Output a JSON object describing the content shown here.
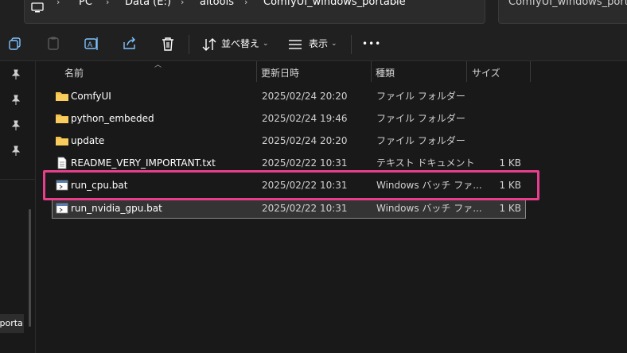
{
  "breadcrumb": {
    "items": [
      "PC",
      "Data (E:)",
      "aitools",
      "ComfyUI_windows_portable"
    ],
    "separator": "›"
  },
  "search": {
    "text": "ComfyUI_windows_porta"
  },
  "toolbar": {
    "sort_label": "並べ替え",
    "view_label": "表示",
    "more_label": "•••"
  },
  "columns": {
    "name": "名前",
    "date": "更新日時",
    "type": "種類",
    "size": "サイズ"
  },
  "files": [
    {
      "icon": "folder-icon",
      "name": "ComfyUI",
      "date": "2025/02/24 20:20",
      "type": "ファイル フォルダー",
      "size": ""
    },
    {
      "icon": "folder-icon",
      "name": "python_embeded",
      "date": "2025/02/24 19:46",
      "type": "ファイル フォルダー",
      "size": ""
    },
    {
      "icon": "folder-icon",
      "name": "update",
      "date": "2025/02/24 20:20",
      "type": "ファイル フォルダー",
      "size": ""
    },
    {
      "icon": "text-file-icon",
      "name": "README_VERY_IMPORTANT.txt",
      "date": "2025/02/22 10:31",
      "type": "テキスト ドキュメント",
      "size": "1 KB"
    },
    {
      "icon": "batch-file-icon",
      "name": "run_cpu.bat",
      "date": "2025/02/22 10:31",
      "type": "Windows バッチ ファ...",
      "size": "1 KB"
    },
    {
      "icon": "batch-file-icon",
      "name": "run_nvidia_gpu.bat",
      "date": "2025/02/22 10:31",
      "type": "Windows バッチ ファ...",
      "size": "1 KB"
    }
  ],
  "nav": {
    "selected_item": "_porta"
  },
  "colors": {
    "highlight": "#e83e8c",
    "folder": "#f5c04a",
    "background": "#191919"
  }
}
